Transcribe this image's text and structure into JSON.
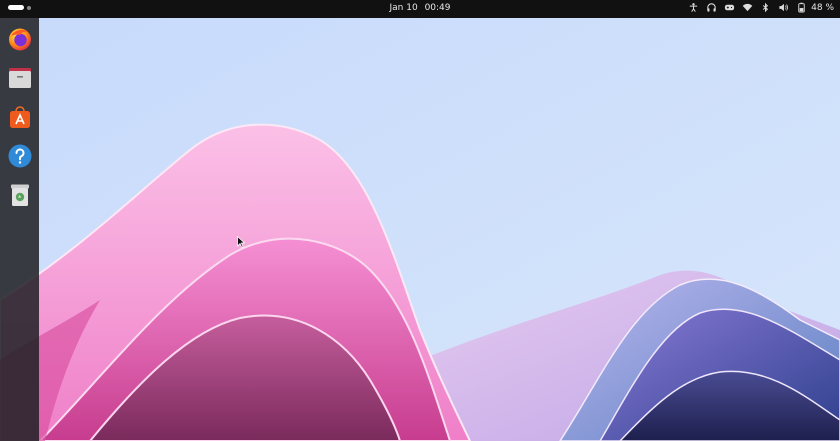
{
  "topbar": {
    "date": "Jan 10",
    "time": "00:49",
    "battery_percent": "48 %",
    "tray_icons": [
      "accessibility-icon",
      "headphones-icon",
      "gamepad-icon",
      "wifi-icon",
      "bluetooth-icon",
      "volume-icon",
      "battery-icon"
    ]
  },
  "dock": {
    "apps": [
      "firefox-icon",
      "files-icon",
      "app-center-icon",
      "help-icon",
      "trash-icon"
    ]
  },
  "colors": {
    "sky": "#cfe0fb",
    "pink": "#f7a6dc",
    "magenta": "#c8418f",
    "purple": "#7a5fc0",
    "navy": "#262a63",
    "dock": "#232328",
    "topbar": "#111111"
  }
}
